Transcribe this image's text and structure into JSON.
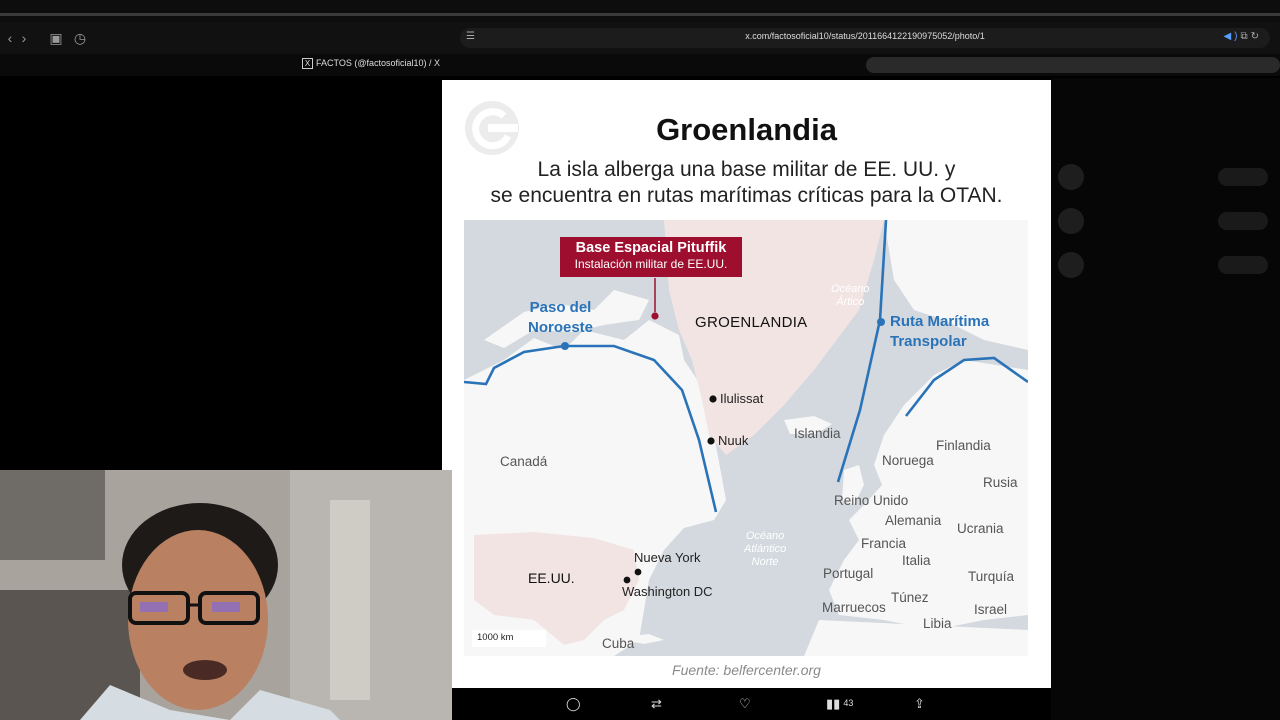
{
  "browser": {
    "url": "x.com/factosoficial10/status/2011664122190975052/photo/1",
    "tab_title": "FACTOS (@factosoficial10) / X"
  },
  "card": {
    "title": "Groenlandia",
    "subtitle_line1": "La isla alberga una base militar de EE. UU. y",
    "subtitle_line2": "se encuentra en rutas marítimas críticas para la OTAN.",
    "source": "Fuente: belfercenter.org"
  },
  "map": {
    "base_title": "Base Espacial Pituffik",
    "base_subtitle": "Instalación militar de EE.UU.",
    "route_nw_line1": "Paso del",
    "route_nw_line2": "Noroeste",
    "route_tp_line1": "Ruta Marítima",
    "route_tp_line2": "Transpolar",
    "greenland": "GROENLANDIA",
    "cities": {
      "ilulissat": "Ilulissat",
      "nuuk": "Nuuk",
      "nueva_york": "Nueva York",
      "washington": "Washington DC"
    },
    "countries": {
      "canada": "Canadá",
      "eeuu": "EE.UU.",
      "cuba": "Cuba",
      "islandia": "Islandia",
      "noruega": "Noruega",
      "finlandia": "Finlandia",
      "rusia": "Rusia",
      "reino_unido": "Reino Unido",
      "alemania": "Alemania",
      "ucrania": "Ucrania",
      "francia": "Francia",
      "italia": "Italia",
      "portugal": "Portugal",
      "turquia": "Turquía",
      "tunez": "Túnez",
      "marruecos": "Marruecos",
      "israel": "Israel",
      "libia": "Libia"
    },
    "oceans": {
      "artico_line1": "Océano",
      "artico_line2": "Ártico",
      "atlantico_line1": "Océano",
      "atlantico_line2": "Atlántico",
      "atlantico_line3": "Norte"
    },
    "scale": "1000 km"
  },
  "actions": {
    "views_count": "43"
  },
  "colors": {
    "route_blue": "#2a73b8",
    "base_red": "#9e0f2f",
    "land_highlight": "#f3e4e4",
    "water": "#d3d9de"
  }
}
